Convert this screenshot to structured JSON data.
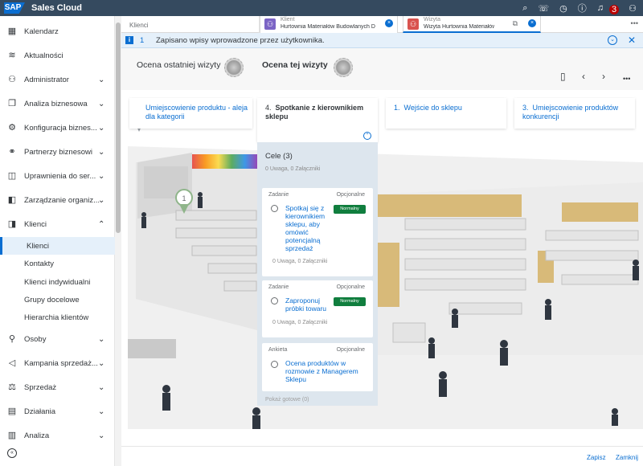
{
  "app": {
    "logo": "SAP",
    "title": "Sales Cloud",
    "notifications_count": "3"
  },
  "topbar_icons": [
    "search-icon",
    "chat-icon",
    "clock-icon",
    "help-icon",
    "bell-icon",
    "user-icon"
  ],
  "sidebar": {
    "items": [
      {
        "label": "Kalendarz",
        "icon": "calendar-icon",
        "chevron": false
      },
      {
        "label": "Aktualności",
        "icon": "feed-icon",
        "chevron": false
      },
      {
        "label": "Administrator",
        "icon": "admin-icon",
        "chevron": true
      },
      {
        "label": "Analiza biznesowa",
        "icon": "report-icon",
        "chevron": true
      },
      {
        "label": "Konfiguracja biznes...",
        "icon": "settings-icon",
        "chevron": true
      },
      {
        "label": "Partnerzy biznesowi",
        "icon": "partner-icon",
        "chevron": true
      },
      {
        "label": "Uprawnienia do ser...",
        "icon": "entitlement-icon",
        "chevron": true
      },
      {
        "label": "Zarządzanie organiz...",
        "icon": "org-icon",
        "chevron": true
      },
      {
        "label": "Klienci",
        "icon": "customer-icon",
        "chevron": true,
        "expanded": true
      },
      {
        "label": "Osoby",
        "icon": "person-icon",
        "chevron": true
      },
      {
        "label": "Kampania sprzedaż...",
        "icon": "campaign-icon",
        "chevron": true
      },
      {
        "label": "Sprzedaż",
        "icon": "sales-icon",
        "chevron": true
      },
      {
        "label": "Działania",
        "icon": "activity-icon",
        "chevron": true
      },
      {
        "label": "Analiza",
        "icon": "analytics-icon",
        "chevron": true
      }
    ],
    "klienci_sub": [
      "Klienci",
      "Kontakty",
      "Klienci indywidualni",
      "Grupy docelowe",
      "Hierarchia klientów"
    ],
    "active_sub": "Klienci"
  },
  "tabs": {
    "first": "Klienci",
    "tab2": {
      "type": "Klient",
      "title": "Hurtownia Materiałów Budowlanych DOM"
    },
    "tab3": {
      "type": "Wizyta",
      "title": "Wizyta Hurtownia Materiałów ..."
    }
  },
  "message": {
    "count": "1",
    "text": "Zapisano wpisy wprowadzone przez użytkownika."
  },
  "header": {
    "last_visit_rating": "Ocena ostatniej wizyty",
    "this_visit_rating": "Ocena tej wizyty"
  },
  "steps": [
    {
      "num": "",
      "label": "Umiejscowienie produktu - aleja dla kategorii"
    },
    {
      "num": "4.",
      "label": "Spotkanie z kierownikiem sklepu"
    },
    {
      "num": "1.",
      "label": "Wejście do sklepu"
    },
    {
      "num": "3.",
      "label": "Umiejscowienie produktów konkurencji"
    }
  ],
  "panel": {
    "title": "Cele (3)",
    "subtitle": "0 Uwaga, 0 Załączniki",
    "cards": [
      {
        "type": "Zadanie",
        "optional": "Opcjonalne",
        "text": "Spotkaj się z kierownikiem sklepu, aby omówić potencjalną sprzedaż",
        "badge": "Normalny",
        "foot": "0 Uwaga, 0 Załączniki"
      },
      {
        "type": "Zadanie",
        "optional": "Opcjonalne",
        "text": "Zaproponuj próbki towaru",
        "badge": "Normalny",
        "foot": "0 Uwaga, 0 Załączniki"
      },
      {
        "type": "Ankieta",
        "optional": "Opcjonalne",
        "text": "Ocena produktów w rozmowie z Managerem Sklepu",
        "badge": "",
        "foot": ""
      }
    ],
    "show_goals": "Pokaż gotowe (0)"
  },
  "footer": {
    "save": "Zapisz",
    "close": "Zamknij"
  }
}
